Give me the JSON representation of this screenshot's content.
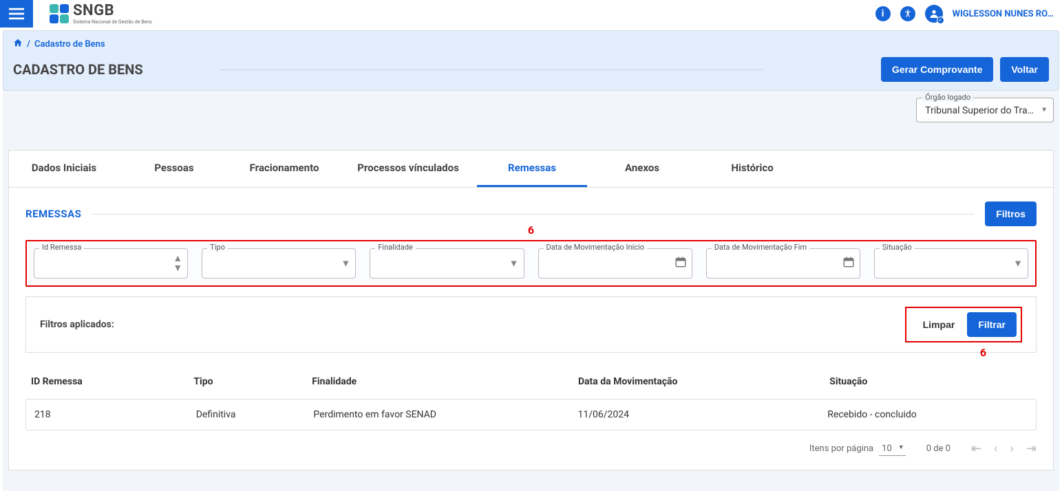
{
  "app": {
    "brand": "SNGB",
    "tagline": "Sistema Nacional de Gestão de Bens",
    "username": "WIGLESSON NUNES RO…"
  },
  "breadcrumb": {
    "home_icon": "home-icon",
    "separator": "/",
    "current": "Cadastro de Bens"
  },
  "page": {
    "title": "CADASTRO DE BENS",
    "actions": {
      "gerar": "Gerar Comprovante",
      "voltar": "Voltar"
    }
  },
  "org": {
    "label": "Órgão logado",
    "value": "Tribunal Superior do Tra…"
  },
  "tabs": [
    {
      "label": "Dados Iniciais",
      "active": false
    },
    {
      "label": "Pessoas",
      "active": false
    },
    {
      "label": "Fracionamento",
      "active": false
    },
    {
      "label": "Processos vínculados",
      "active": false
    },
    {
      "label": "Remessas",
      "active": true
    },
    {
      "label": "Anexos",
      "active": false
    },
    {
      "label": "Histórico",
      "active": false
    }
  ],
  "panel": {
    "title": "REMESSAS",
    "filtros_btn": "Filtros"
  },
  "annotations": {
    "top": "6",
    "bottom": "6"
  },
  "filters": {
    "id_remessa": {
      "label": "Id Remessa",
      "value": ""
    },
    "tipo": {
      "label": "Tipo",
      "value": ""
    },
    "finalidade": {
      "label": "Finalidade",
      "value": ""
    },
    "data_inicio": {
      "label": "Data de Movimentação Início",
      "value": ""
    },
    "data_fim": {
      "label": "Data de Movimentação Fim",
      "value": ""
    },
    "situacao": {
      "label": "Situação",
      "value": ""
    }
  },
  "applied": {
    "label": "Filtros aplicados:",
    "limpar": "Limpar",
    "filtrar": "Filtrar"
  },
  "table": {
    "headers": {
      "id": "ID Remessa",
      "tipo": "Tipo",
      "finalidade": "Finalidade",
      "data": "Data da Movimentação",
      "situacao": "Situação"
    },
    "rows": [
      {
        "id": "218",
        "tipo": "Definitiva",
        "finalidade": "Perdimento em favor SENAD",
        "data": "11/06/2024",
        "situacao": "Recebido - concluido"
      }
    ]
  },
  "pagination": {
    "items_label": "Itens por página",
    "page_size": "10",
    "range": "0 de 0"
  }
}
